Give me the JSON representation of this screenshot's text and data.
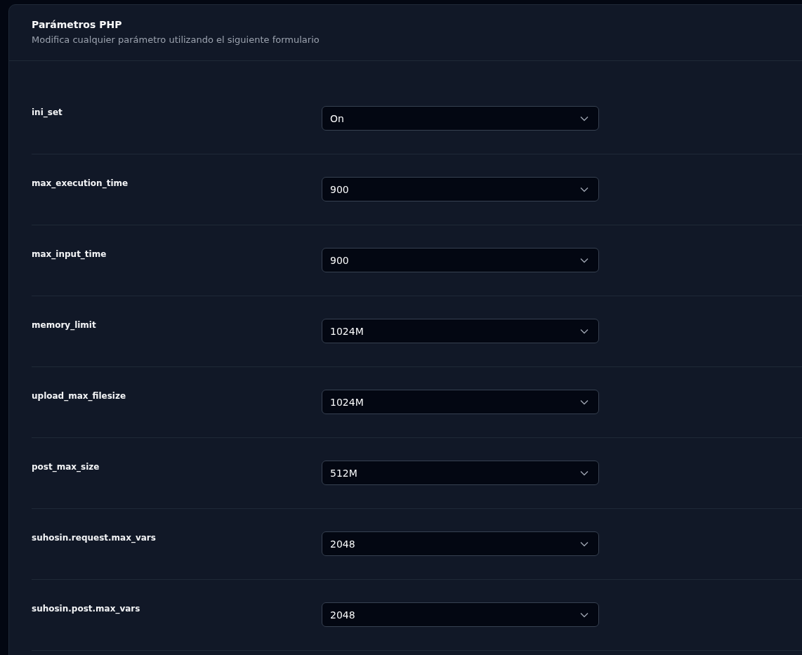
{
  "panel": {
    "title": "Parámetros PHP",
    "subtitle": "Modifica cualquier parámetro utilizando el siguiente formulario"
  },
  "parameters": [
    {
      "name": "ini_set",
      "value": "On"
    },
    {
      "name": "max_execution_time",
      "value": "900"
    },
    {
      "name": "max_input_time",
      "value": "900"
    },
    {
      "name": "memory_limit",
      "value": "1024M"
    },
    {
      "name": "upload_max_filesize",
      "value": "1024M"
    },
    {
      "name": "post_max_size",
      "value": "512M"
    },
    {
      "name": "suhosin.request.max_vars",
      "value": "2048"
    },
    {
      "name": "suhosin.post.max_vars",
      "value": "2048"
    }
  ]
}
